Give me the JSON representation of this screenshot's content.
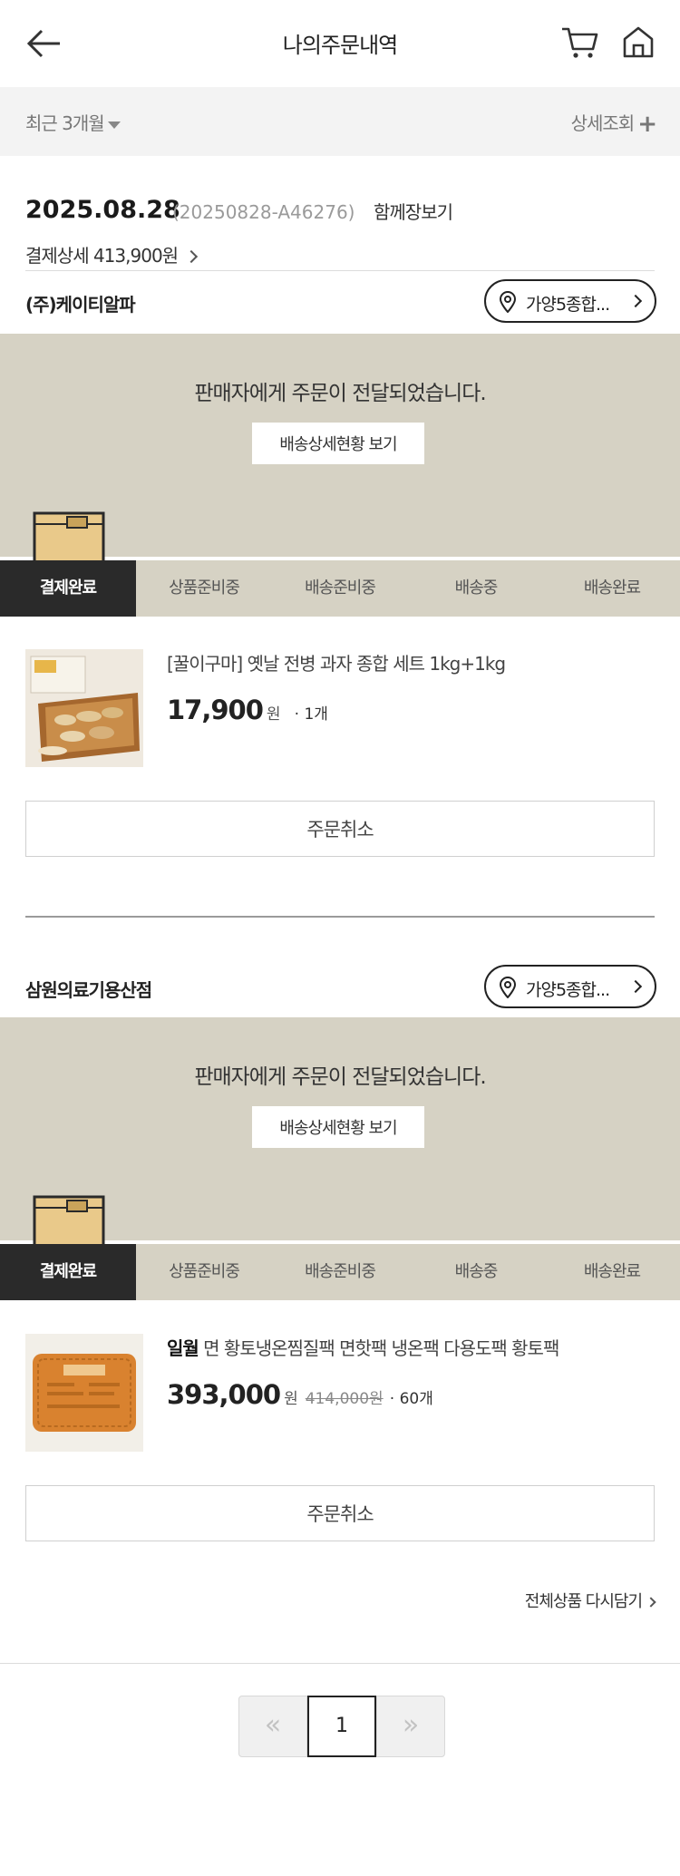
{
  "header": {
    "title": "나의주문내역",
    "icons": [
      "back-arrow-icon",
      "cart-icon",
      "home-icon"
    ]
  },
  "filter": {
    "period": "최근 3개월",
    "detail": "상세조회"
  },
  "order": {
    "date": "2025.08.28",
    "number": "(20250828-A46276)",
    "together_label": "함께장보기",
    "payment_label": "결제상세 413,900원"
  },
  "groups": [
    {
      "seller": "(주)케이티알파",
      "location": "가양5종합...",
      "status_message": "판매자에게 주문이 전달되었습니다.",
      "track_label": "배송상세현황 보기",
      "steps": [
        "결제완료",
        "상품준비중",
        "배송준비중",
        "배송중",
        "배송완료"
      ],
      "active_step": "결제완료",
      "product": {
        "brand": "",
        "name": "[꿀이구마] 옛날 전병 과자 종합 세트 1kg+1kg",
        "price": "17,900",
        "unit": "원",
        "original_price": "",
        "quantity": "· 1개"
      },
      "cancel_label": "주문취소"
    },
    {
      "seller": "삼원의료기용산점",
      "location": "가양5종합...",
      "status_message": "판매자에게 주문이 전달되었습니다.",
      "track_label": "배송상세현황 보기",
      "steps": [
        "결제완료",
        "상품준비중",
        "배송준비중",
        "배송중",
        "배송완료"
      ],
      "active_step": "결제완료",
      "product": {
        "brand": "일월",
        "name": " 면 황토냉온찜질팩 면핫팩 냉온팩 다용도팩 황토팩",
        "price": "393,000",
        "unit": "원",
        "original_price": "414,000원",
        "quantity": "· 60개"
      },
      "cancel_label": "주문취소"
    }
  ],
  "reorder_label": "전체상품 다시담기",
  "pagination": {
    "prev": "«",
    "current": "1",
    "next": "»"
  },
  "colors": {
    "status_bg": "#d6d2c4",
    "active_step_bg": "#2a2a2a",
    "filter_bg": "#f3f3f3"
  }
}
